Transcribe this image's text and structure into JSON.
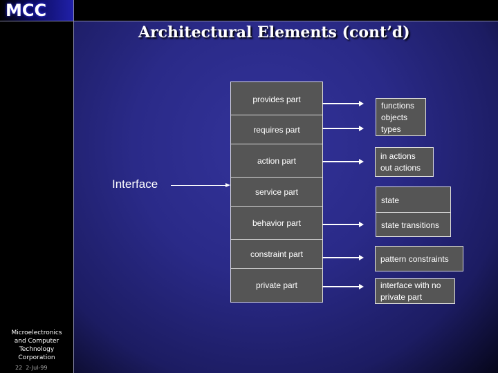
{
  "logo": {
    "text": "MCC"
  },
  "title": "Architectural Elements (cont’d)",
  "footer": {
    "organization_lines": [
      "Microelectronics",
      "and Computer",
      "Technology",
      "Corporation"
    ],
    "page_number": "22",
    "date": "2-Jul-99"
  },
  "diagram": {
    "source_label": "Interface",
    "parts": [
      "provides part",
      "requires part",
      "action part",
      "service part",
      "behavior part",
      "constraint part",
      "private part"
    ],
    "targets": [
      {
        "lines": [
          "functions",
          "objects",
          "types"
        ]
      },
      {
        "lines": [
          "in actions",
          "out actions"
        ]
      },
      {
        "lines": [
          "state"
        ]
      },
      {
        "lines": [
          "state transitions"
        ]
      },
      {
        "lines": [
          "pattern constraints"
        ]
      },
      {
        "lines": [
          "interface with no",
          "private part"
        ]
      }
    ]
  },
  "colors": {
    "background": "#2a2a88",
    "box_fill": "#555555",
    "box_border": "#dddddd",
    "text": "#ffffff"
  }
}
